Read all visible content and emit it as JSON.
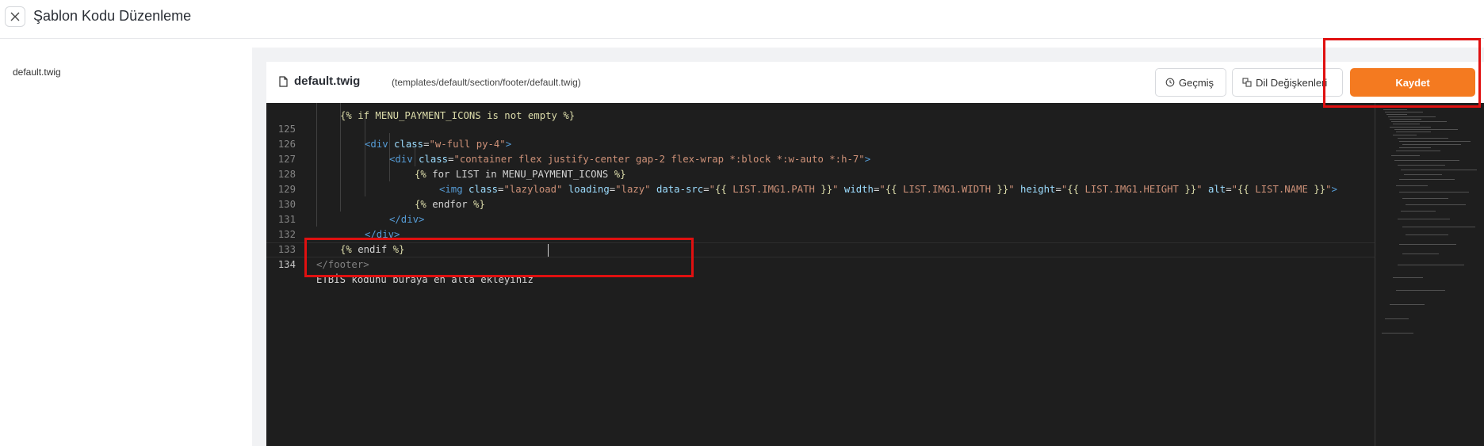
{
  "header": {
    "close_label": "×",
    "title": "Şablon Kodu Düzenleme"
  },
  "sidebar": {
    "files": [
      "default.twig"
    ]
  },
  "editor": {
    "file_name": "default.twig",
    "file_path": "(templates/default/section/footer/default.twig)",
    "buttons": {
      "history": "Geçmiş",
      "language_vars": "Dil Değişkenleri",
      "save": "Kaydet"
    },
    "colors": {
      "save_button": "#f47a20",
      "editor_bg": "#1e1e1e",
      "annotation": "#e01010"
    },
    "line_numbers": [
      "125",
      "126",
      "127",
      "128",
      "129",
      "130",
      "131",
      "132",
      "133",
      "134"
    ],
    "code_lines": {
      "l125_open": "<",
      "l125_tag": "div",
      "l125_attr": "class",
      "l125_eq": "=",
      "l125_val": "\"w-full py-4\"",
      "l125_close": ">",
      "l126_open": "<",
      "l126_tag": "div",
      "l126_attr": "class",
      "l126_eq": "=",
      "l126_val": "\"container flex justify-center gap-2 flex-wrap *:block *:w-auto *:h-7\"",
      "l126_close": ">",
      "l127_a": "{%",
      "l127_b": " for LIST in MENU_PAYMENT_ICONS ",
      "l127_c": "%}",
      "l128_open": "<",
      "l128_tag": "img",
      "l128_a1": " class",
      "l128_v1": "\"lazyload\"",
      "l128_a2": " loading",
      "l128_v2": "\"lazy\"",
      "l128_a3": " data-src",
      "l128_v3a": "\"",
      "l128_v3b": "{{",
      "l128_v3c": " LIST.IMG1.PATH ",
      "l128_v3d": "}}",
      "l128_v3e": "\"",
      "l128_a4": " width",
      "l128_v4a": "\"",
      "l128_v4b": "{{",
      "l128_v4c": " LIST.IMG1.WIDTH ",
      "l128_v4d": "}}",
      "l128_v4e": "\"",
      "l128_a5": " height",
      "l128_v5a": "\"",
      "l128_v5b": "{{",
      "l128_v5c": " LIST.IMG1.HEIGHT ",
      "l128_v5d": "}}",
      "l128_v5e": "\"",
      "l128_a6": " alt",
      "l128_v6a": "\"",
      "l128_v6b": "{{",
      "l128_v6c": " LIST.NAME ",
      "l128_v6d": "}}",
      "l128_v6e": "\"",
      "l128_close": ">",
      "l129_a": "{%",
      "l129_b": " endfor ",
      "l129_c": "%}",
      "l130": "</div>",
      "l131": "</div>",
      "l132_a": "{%",
      "l132_b": " endif ",
      "l132_c": "%}",
      "l133": "</footer>",
      "l134": "ETBİS kodunu buraya en alta ekleyiniz"
    }
  }
}
